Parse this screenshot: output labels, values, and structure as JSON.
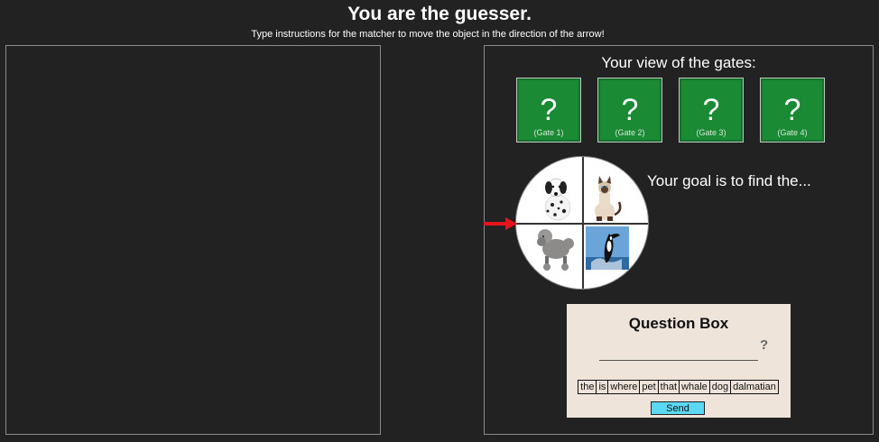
{
  "header": {
    "title": "You are the guesser.",
    "subtitle": "Type instructions for the matcher to move the object in the direction of the arrow!"
  },
  "gates": {
    "title": "Your view of the gates:",
    "items": [
      {
        "symbol": "?",
        "label": "(Gate 1)"
      },
      {
        "symbol": "?",
        "label": "(Gate 2)"
      },
      {
        "symbol": "?",
        "label": "(Gate 3)"
      },
      {
        "symbol": "?",
        "label": "(Gate 4)"
      }
    ],
    "color": "#1a8a34"
  },
  "wheel": {
    "quadrants": [
      "dalmatian-image",
      "siamese-cat-image",
      "poodle-image",
      "orca-whale-image"
    ],
    "arrow_color": "#e8141c"
  },
  "goal": {
    "text": "Your goal is to find the..."
  },
  "question_box": {
    "title": "Question Box",
    "help": "?",
    "words": [
      "the",
      "is",
      "where",
      "pet",
      "that",
      "whale",
      "dog",
      "dalmatian"
    ],
    "send_label": "Send",
    "send_color": "#5bd8f4"
  }
}
